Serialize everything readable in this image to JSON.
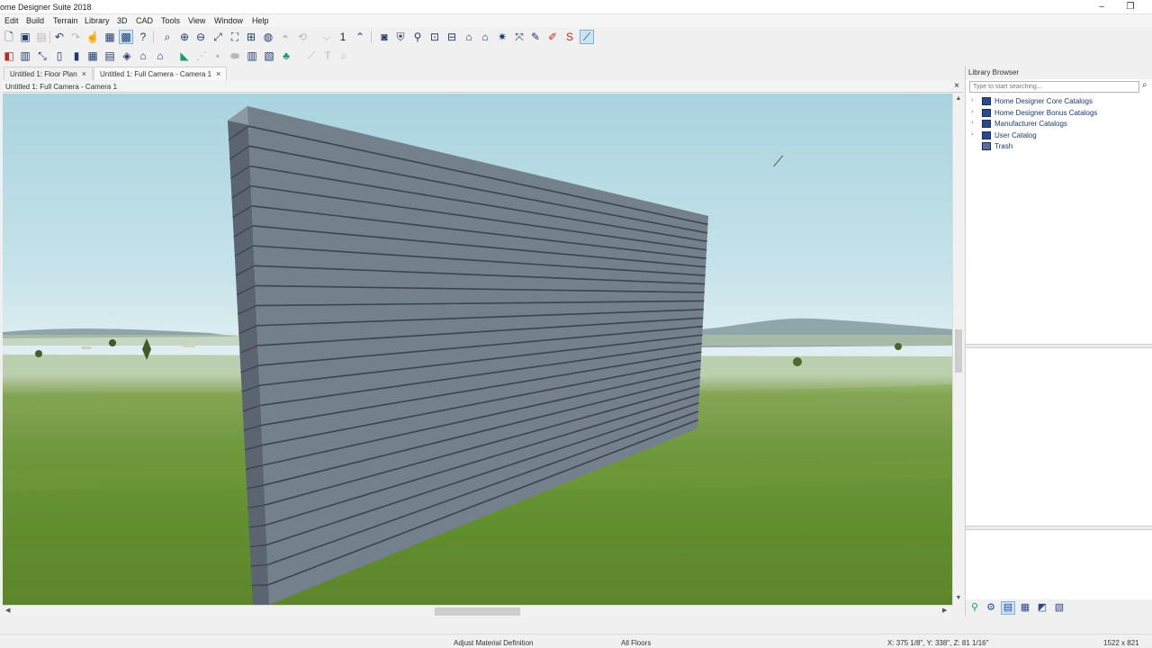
{
  "titlebar": {
    "title": "ome Designer Suite 2018",
    "minimize": "‒",
    "restore": "❐",
    "close": "×"
  },
  "menu": [
    "Edit",
    "Build",
    "Terrain",
    "Library",
    "3D",
    "CAD",
    "Tools",
    "View",
    "Window",
    "Help"
  ],
  "toolbar": {
    "floor_number": "1"
  },
  "tabs": [
    {
      "label": "Untitled 1: Floor Plan",
      "close": "×"
    },
    {
      "label": "Untitled 1: Full Camera - Camera 1",
      "close": "×"
    }
  ],
  "document": {
    "title": "Untitled 1: Full Camera - Camera 1",
    "close": "×"
  },
  "scene": {
    "wall_color": "#75808d",
    "siding_board_count": 24
  },
  "library": {
    "title": "Library Browser",
    "search_placeholder": "Type to start searching...",
    "items": [
      {
        "label": "Home Designer Core Catalogs",
        "expandable": true
      },
      {
        "label": "Home Designer Bonus Catalogs",
        "expandable": true
      },
      {
        "label": "Manufacturer Catalogs",
        "expandable": true
      },
      {
        "label": "User Catalog",
        "expandable": true
      },
      {
        "label": "Trash",
        "expandable": false
      }
    ]
  },
  "status": {
    "mode": "Adjust Material Definition",
    "floors": "All Floors",
    "coords": "X: 375 1/8\", Y: 338\", Z: 81 1/16\"",
    "size": "1522 x 821"
  }
}
